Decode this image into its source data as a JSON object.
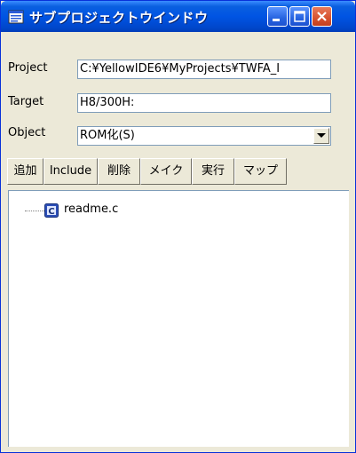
{
  "window": {
    "title": "サブプロジェクトウインドウ"
  },
  "form": {
    "project": {
      "label": "Project",
      "value": "C:¥YellowIDE6¥MyProjects¥TWFA_I"
    },
    "target": {
      "label": "Target",
      "value": "H8/300H:"
    },
    "object": {
      "label": "Object",
      "value": "ROM化(S)"
    }
  },
  "toolbar": {
    "buttons": [
      "追加",
      "Include",
      "削除",
      "メイク",
      "実行",
      "マップ"
    ]
  },
  "tree": {
    "items": [
      {
        "name": "readme.c",
        "icon": "c-source-file-icon"
      }
    ]
  },
  "colors": {
    "titlebar": "#0054E3",
    "window_bg": "#ECE9D8",
    "close_button": "#D6522F",
    "field_border": "#7F9DB9"
  }
}
